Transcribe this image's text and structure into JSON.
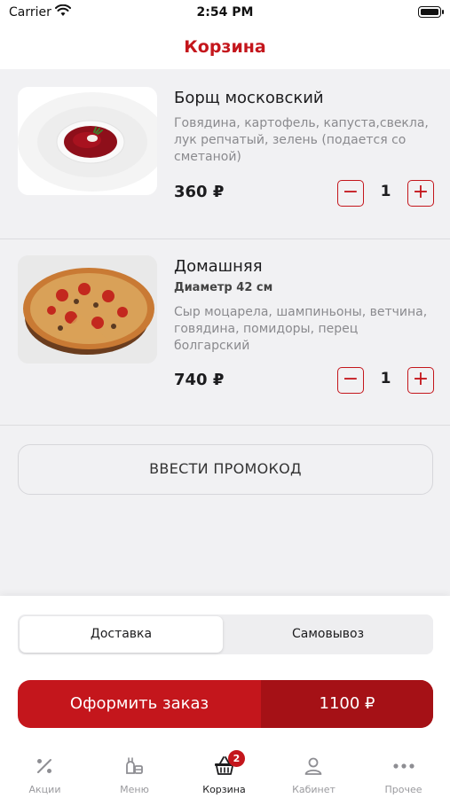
{
  "status_bar": {
    "carrier": "Carrier",
    "time": "2:54 PM"
  },
  "nav": {
    "title": "Корзина"
  },
  "cart": {
    "items": [
      {
        "name": "Борщ московский",
        "size": "",
        "description": "Говядина, картофель, капуста,свекла, лук репчатый, зелень (подается со сметаной)",
        "price": "360 ₽",
        "quantity": "1"
      },
      {
        "name": "Домашняя",
        "size": "Диаметр 42 см",
        "description": "Сыр моцарела, шампиньоны, ветчина, говядина, помидоры, перец болгарский",
        "price": "740 ₽",
        "quantity": "1"
      }
    ],
    "stepper": {
      "minus": "−",
      "plus": "+"
    }
  },
  "promo": {
    "label": "ВВЕСТИ ПРОМОКОД"
  },
  "delivery_toggle": {
    "options": [
      "Доставка",
      "Самовывоз"
    ],
    "selected": "Доставка"
  },
  "order": {
    "label": "Оформить заказ",
    "total": "1100 ₽"
  },
  "tab_bar": {
    "tabs": [
      {
        "label": "Акции",
        "icon": "percent-icon"
      },
      {
        "label": "Меню",
        "icon": "menu-food-icon"
      },
      {
        "label": "Корзина",
        "icon": "basket-icon",
        "badge": "2",
        "active": true
      },
      {
        "label": "Кабинет",
        "icon": "person-icon"
      },
      {
        "label": "Прочее",
        "icon": "more-dots-icon"
      }
    ]
  },
  "colors": {
    "accent": "#c4161c",
    "accent_dark": "#a51116",
    "background": "#f1f1f3"
  }
}
